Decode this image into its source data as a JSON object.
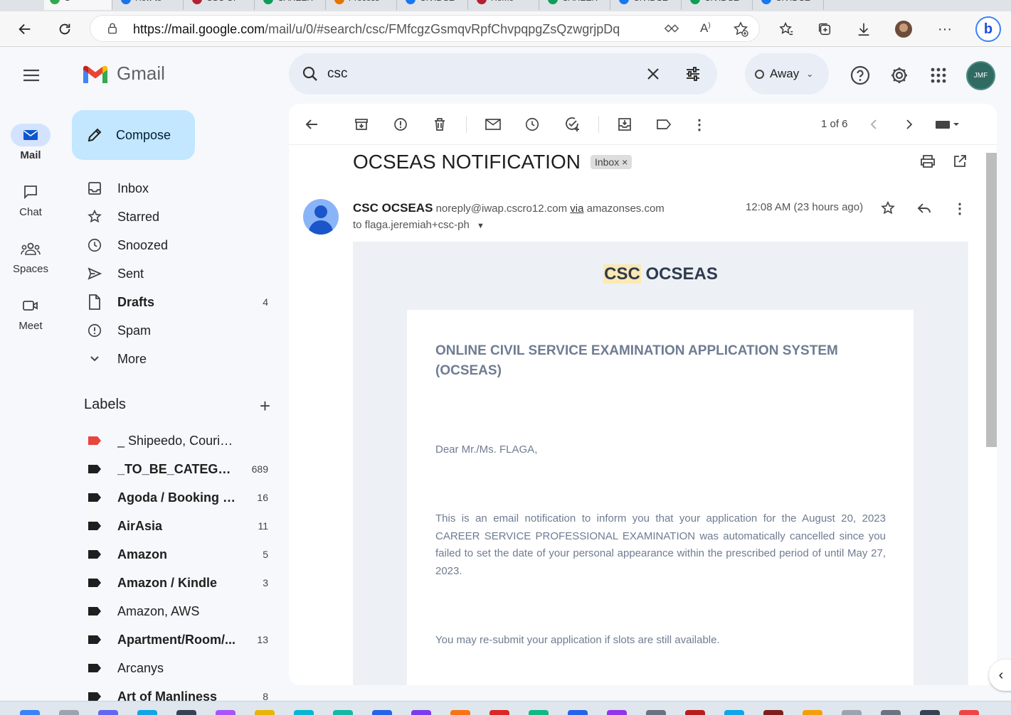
{
  "browser": {
    "tabs": [
      {
        "label": "G",
        "color": "#34a853"
      },
      {
        "label": "How to",
        "color": "#1a73e8"
      },
      {
        "label": "CSC OF",
        "color": "#b22234"
      },
      {
        "label": "CAREER",
        "color": "#0f9d58"
      },
      {
        "label": "Process",
        "color": "#e37400"
      },
      {
        "label": "CIVIL SE",
        "color": "#1877f2"
      },
      {
        "label": "Home",
        "color": "#b22234"
      },
      {
        "label": "CAREER",
        "color": "#0f9d58"
      },
      {
        "label": "CIVIL SE",
        "color": "#1877f2"
      },
      {
        "label": "CIVIL SE",
        "color": "#0f9d58"
      },
      {
        "label": "CIVIL SE",
        "color": "#1877f2"
      }
    ],
    "url_host": "https://mail.google.com",
    "url_path": "/mail/u/0/#search/csc/FMfcgzGsmqvRpfChvpqpgZsQzwgrjpDq"
  },
  "header": {
    "logo_text": "Gmail",
    "search_value": "csc",
    "status": "Away",
    "avatar_initials": "JMF"
  },
  "rail": [
    {
      "label": "Mail",
      "icon": "mail-icon"
    },
    {
      "label": "Chat",
      "icon": "chat-icon"
    },
    {
      "label": "Spaces",
      "icon": "spaces-icon"
    },
    {
      "label": "Meet",
      "icon": "meet-icon"
    }
  ],
  "compose_label": "Compose",
  "nav": {
    "inbox": "Inbox",
    "starred": "Starred",
    "snoozed": "Snoozed",
    "sent": "Sent",
    "drafts": "Drafts",
    "drafts_count": "4",
    "spam": "Spam",
    "more": "More"
  },
  "labels_heading": "Labels",
  "labels": [
    {
      "name": "_ Shipeedo, Couriers an...",
      "count": "",
      "color": "#e8453c",
      "bold": false
    },
    {
      "name": "_TO_BE_CATEGO...",
      "count": "689",
      "color": "#1f1f1f",
      "bold": true
    },
    {
      "name": "Agoda / Booking / ...",
      "count": "16",
      "color": "#1f1f1f",
      "bold": true
    },
    {
      "name": "AirAsia",
      "count": "11",
      "color": "#1f1f1f",
      "bold": true
    },
    {
      "name": "Amazon",
      "count": "5",
      "color": "#1f1f1f",
      "bold": true
    },
    {
      "name": "Amazon / Kindle",
      "count": "3",
      "color": "#1f1f1f",
      "bold": true
    },
    {
      "name": "Amazon, AWS",
      "count": "",
      "color": "#1f1f1f",
      "bold": false
    },
    {
      "name": "Apartment/Room/...",
      "count": "13",
      "color": "#1f1f1f",
      "bold": true
    },
    {
      "name": "Arcanys",
      "count": "",
      "color": "#1f1f1f",
      "bold": false
    },
    {
      "name": "Art of Manliness",
      "count": "8",
      "color": "#1f1f1f",
      "bold": true
    }
  ],
  "toolbar": {
    "pager": "1 of 6"
  },
  "email": {
    "subject": "OCSEAS NOTIFICATION",
    "chip": "Inbox",
    "sender_name": "CSC OCSEAS",
    "sender_email": "noreply@iwap.cscro12.com",
    "via_word": "via",
    "via_domain": "amazonses.com",
    "to": "to flaga.jeremiah+csc-ph",
    "time": "12:08 AM (23 hours ago)",
    "brand_hl": "CSC",
    "brand_rest": "OCSEAS",
    "card_title": "ONLINE CIVIL SERVICE EXAMINATION APPLICATION SYSTEM (OCSEAS)",
    "greeting": "Dear Mr./Ms. FLAGA,",
    "paragraph": "This is an email notification to inform you that your application for the August 20, 2023 CAREER SERVICE PROFESSIONAL EXAMINATION was automatically cancelled since you failed to set the date of your personal appearance within the prescribed period of until May 27, 2023.",
    "resubmit": "You may re-submit your application if slots are still available."
  }
}
